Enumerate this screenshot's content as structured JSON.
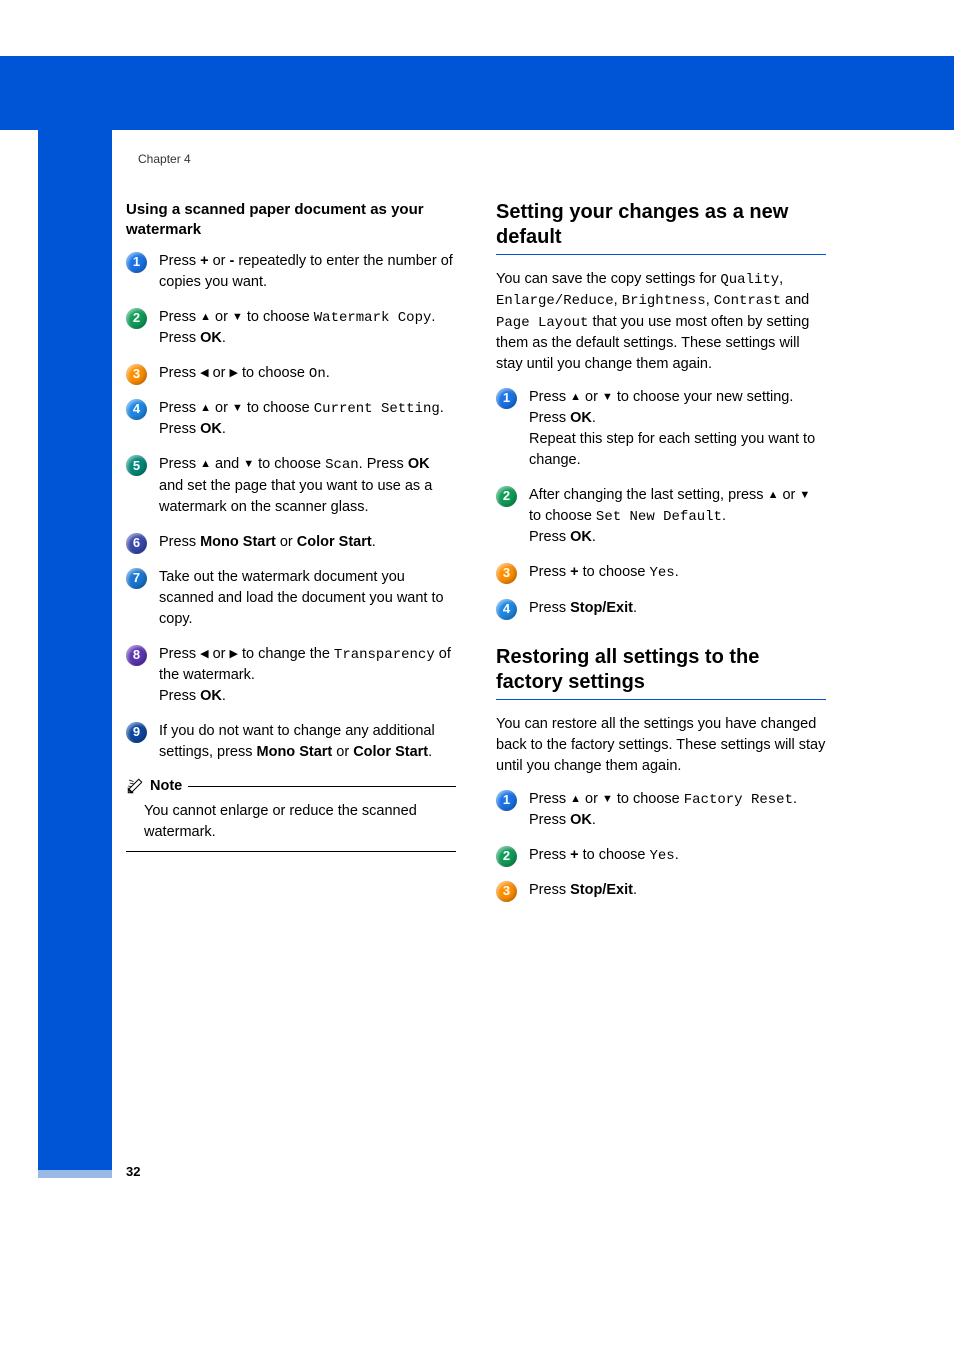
{
  "chapter_label": "Chapter 4",
  "page_number": "32",
  "left": {
    "section_title": "Using a scanned paper document as your watermark",
    "steps": [
      {
        "pre": "Press ",
        "b1": "+",
        "mid1": " or ",
        "b2": "-",
        "post": " repeatedly to enter the number of copies you want."
      },
      {
        "pre": "Press ",
        "upText": "a",
        "mid1": " or ",
        "dnText": "b",
        "mid2": " to choose ",
        "mono": "Watermark Copy",
        "post": ".",
        "br": true,
        "preb": "Press ",
        "b3": "OK",
        "post2": "."
      },
      {
        "pre": "Press ",
        "ltText": "d",
        "mid1": " or ",
        "rtText": "c",
        "mid2": " to choose ",
        "mono": "On",
        "post": "."
      },
      {
        "pre": "Press ",
        "upText": "a",
        "mid1": " or ",
        "dnText": "b",
        "mid2": " to choose ",
        "mono": "Current Setting",
        "post": ".",
        "br": true,
        "preb": "Press ",
        "b3": "OK",
        "post2": "."
      },
      {
        "pre": "Press ",
        "upText": "a",
        "mid1": " and ",
        "dnText": "b",
        "mid2": " to choose ",
        "mono": "Scan",
        "post": ". Press ",
        "b3": "OK",
        "post2": " and set the page that you want to use as a watermark on the scanner glass."
      },
      {
        "pre": "Press ",
        "b1": "Mono Start",
        "mid1": " or ",
        "b2": "Color Start",
        "post": "."
      },
      {
        "plain": "Take out the watermark document you scanned and load the document you want to copy."
      },
      {
        "pre": "Press ",
        "ltText": "d",
        "mid1": " or ",
        "rtText": "c",
        "mid2": " to change the ",
        "mono": "Transparency",
        "post": " of the watermark.",
        "br": true,
        "preb": "Press ",
        "b3": "OK",
        "post2": "."
      },
      {
        "pre": "If you do not want to change any additional settings, press ",
        "b1": "Mono Start",
        "mid1": " or ",
        "b2": "Color Start",
        "post": "."
      }
    ],
    "note_label": "Note",
    "note_text": "You cannot enlarge or reduce the scanned watermark."
  },
  "right": {
    "h2a": "Setting your changes as a new default",
    "para_a_1": "You can save the copy settings for ",
    "para_a_m1": "Quality",
    "para_a_2": ", ",
    "para_a_m2": "Enlarge/Reduce",
    "para_a_3": ", ",
    "para_a_m3": "Brightness",
    "para_a_4": ", ",
    "para_a_m4": "Contrast",
    "para_a_5": " and ",
    "para_a_m5": "Page Layout",
    "para_a_6": " that you use most often by setting them as the default settings. These settings will stay until you change them again.",
    "steps_a": [
      {
        "pre": "Press ",
        "upText": "a",
        "mid1": " or ",
        "dnText": "b",
        "mid2": " to choose your new setting.",
        "br": true,
        "preb": "Press ",
        "b3": "OK",
        "post2": ".",
        "br2": true,
        "tail": "Repeat this step for each setting you want to change."
      },
      {
        "pre": "After changing the last setting, press ",
        "upText": "a",
        "mid1": " or ",
        "dnText": "b",
        "mid2": " to choose ",
        "mono": "Set New Default",
        "post": ".",
        "br": true,
        "preb": "Press ",
        "b3": "OK",
        "post2": "."
      },
      {
        "pre": "Press ",
        "b1": "+",
        "mid1": " to choose ",
        "mono": "Yes",
        "post": "."
      },
      {
        "pre": "Press ",
        "b1": "Stop/Exit",
        "post": "."
      }
    ],
    "h2b": "Restoring all settings to the factory settings",
    "para_b": "You can restore all the settings you have changed back to the factory settings. These settings will stay until you change them again.",
    "steps_b": [
      {
        "pre": "Press ",
        "upText": "a",
        "mid1": " or ",
        "dnText": "b",
        "mid2": " to choose ",
        "mono": "Factory Reset",
        "post": ".",
        "br": true,
        "preb": "Press ",
        "b3": "OK",
        "post2": "."
      },
      {
        "pre": "Press ",
        "b1": "+",
        "mid1": " to choose ",
        "mono": "Yes",
        "post": "."
      },
      {
        "pre": "Press ",
        "b1": "Stop/Exit",
        "post": "."
      }
    ]
  },
  "chart_data": null
}
